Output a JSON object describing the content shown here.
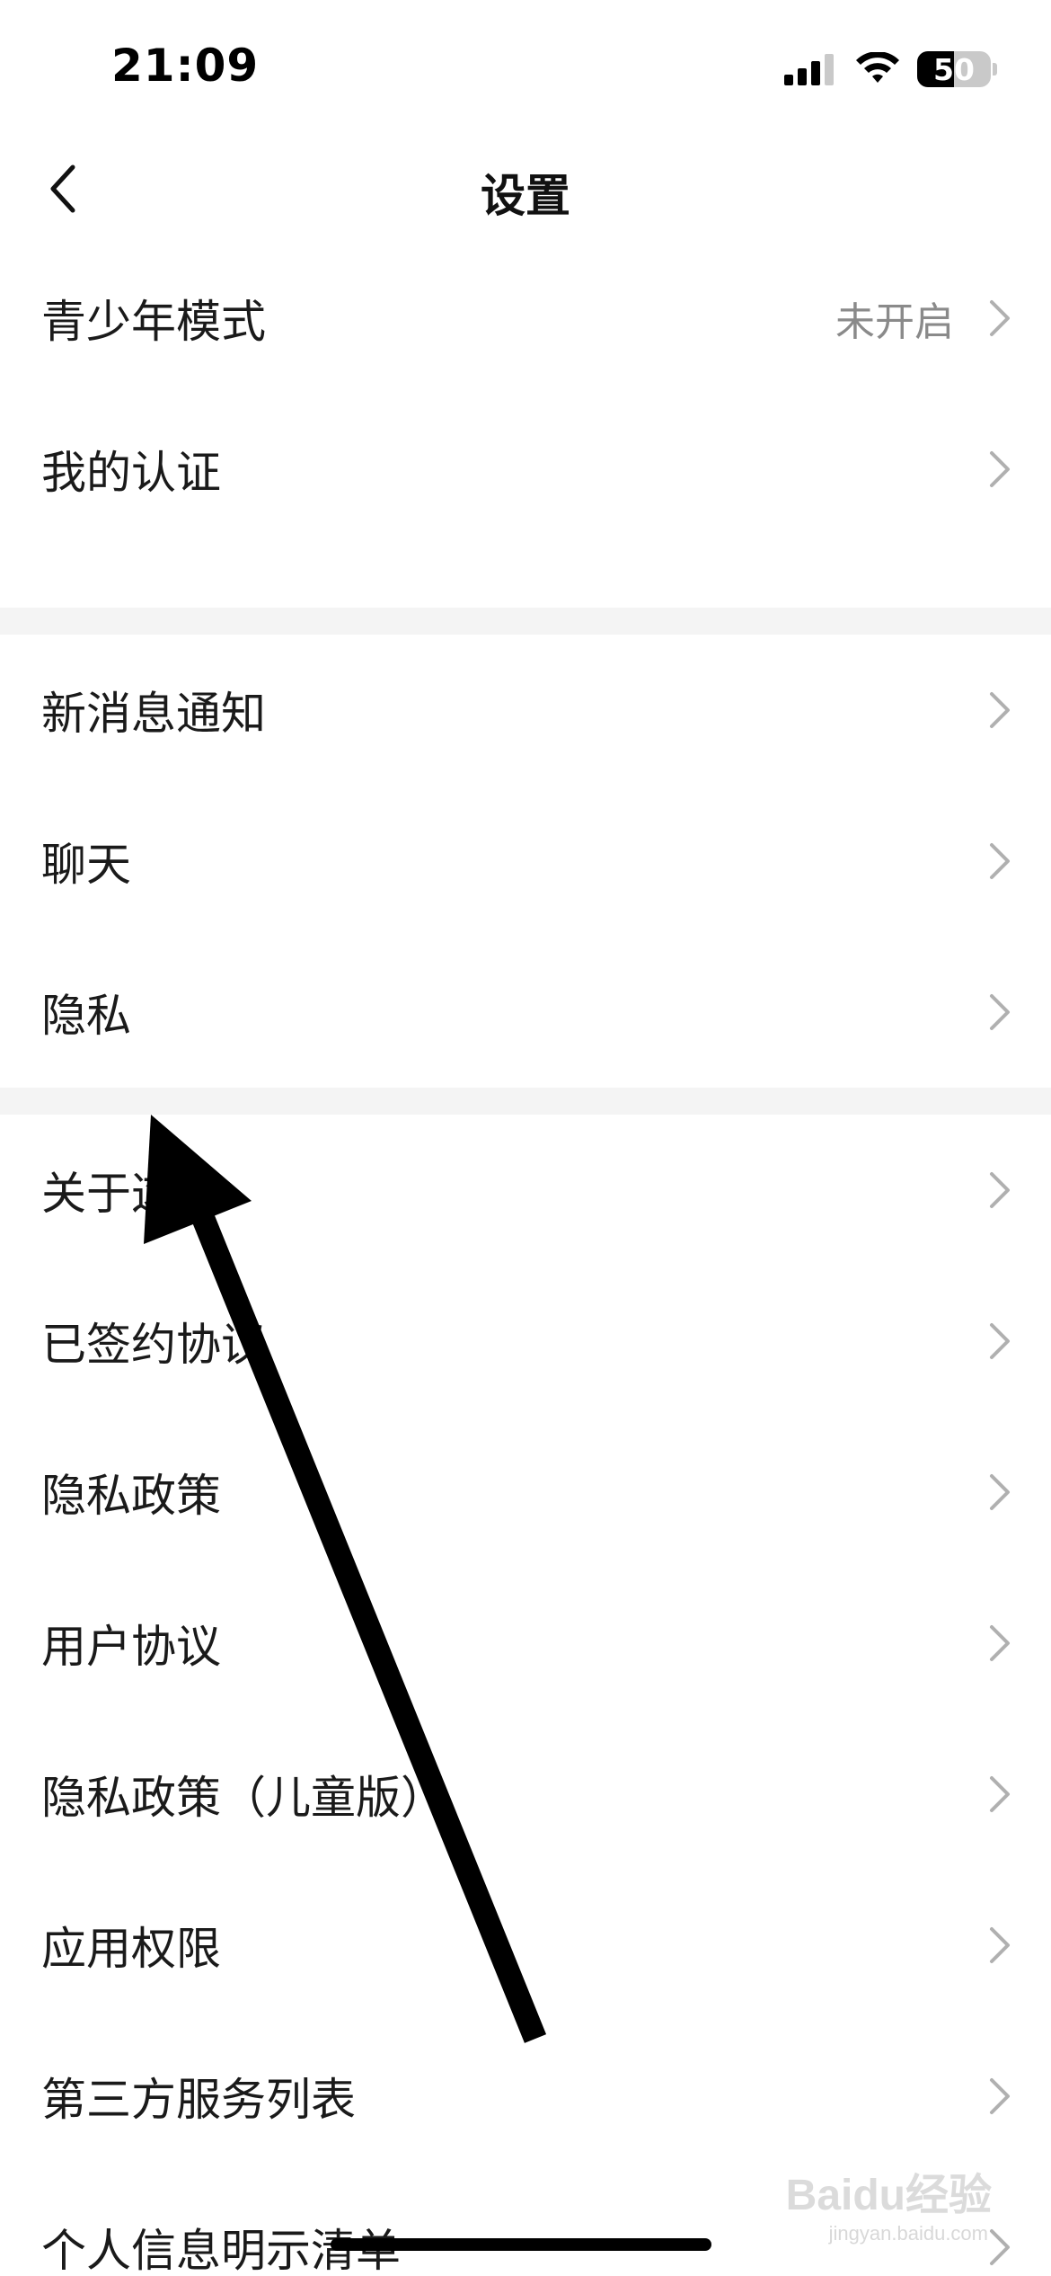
{
  "status_bar": {
    "time": "21:09",
    "battery_level": 50,
    "battery_text": "50",
    "icons": [
      "cellular-signal-icon",
      "wifi-icon",
      "battery-icon"
    ]
  },
  "nav": {
    "title": "设置",
    "back_icon": "chevron-left-icon"
  },
  "groups": [
    {
      "items": [
        {
          "label": "青少年模式",
          "value": "未开启"
        },
        {
          "label": "我的认证",
          "value": ""
        }
      ]
    },
    {
      "items": [
        {
          "label": "新消息通知",
          "value": ""
        },
        {
          "label": "聊天",
          "value": ""
        },
        {
          "label": "隐私",
          "value": ""
        }
      ]
    },
    {
      "items": [
        {
          "label": "关于这",
          "value": ""
        },
        {
          "label": "已签约协议",
          "value": ""
        },
        {
          "label": "隐私政策",
          "value": ""
        },
        {
          "label": "用户协议",
          "value": ""
        },
        {
          "label": "隐私政策（儿童版）",
          "value": ""
        },
        {
          "label": "应用权限",
          "value": ""
        },
        {
          "label": "第三方服务列表",
          "value": ""
        },
        {
          "label": "个人信息明示清单",
          "value": ""
        }
      ]
    }
  ],
  "colors": {
    "background": "#ffffff",
    "separator": "#f4f4f4",
    "value_text": "#8a8a8a",
    "chevron": "#b0b0b0",
    "arrow": "#000000"
  },
  "watermark": {
    "main": "Baidu经验",
    "sub": "jingyan.baidu.com"
  }
}
